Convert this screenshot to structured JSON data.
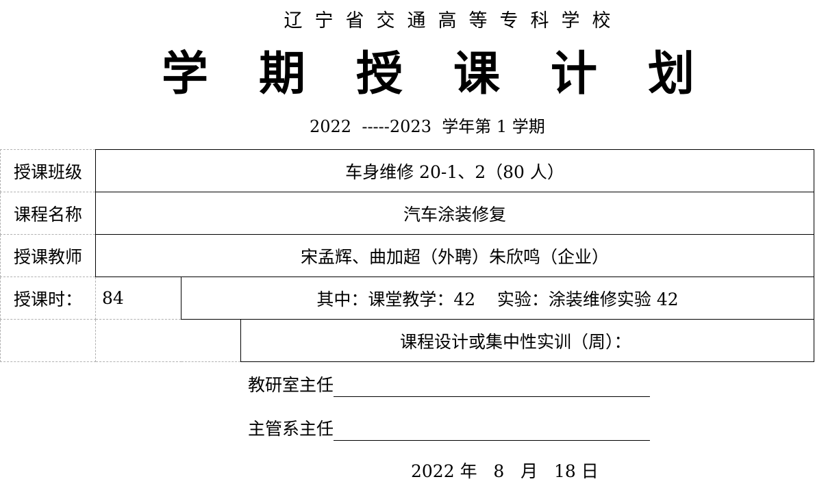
{
  "header": {
    "school": "辽宁省交通高等专科学校",
    "title": "学期授课计划",
    "term_line": "2022  -----2023  学年第 1 学期"
  },
  "table": {
    "class_label": "授课班级",
    "class_value": "车身维修 20-1、2（80 人）",
    "course_label": "课程名称",
    "course_value": "汽车涂装修复",
    "teacher_label": "授课教师",
    "teacher_value": "宋孟辉、曲加超（外聘）朱欣鸣（企业）",
    "hours_label": "授课时：",
    "hours_value": "84",
    "hours_breakdown": "其中：课堂教学：42    实验：涂装维修实验 42",
    "practice_label": "课程设计或集中性实训（周）："
  },
  "signatures": {
    "director_label": "教研室主任",
    "dept_head_label": "主管系主任"
  },
  "date": {
    "text": "2022 年   8   月   18 日"
  }
}
